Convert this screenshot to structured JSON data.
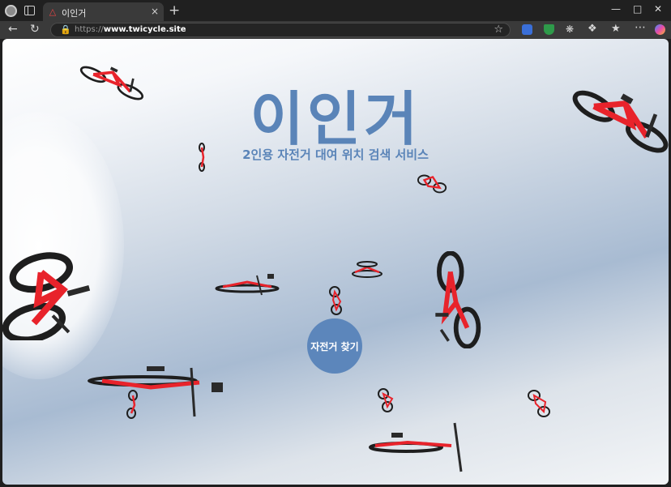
{
  "browser": {
    "tab_title": "이인거",
    "new_tab_symbol": "+",
    "close_symbol": "×",
    "url_scheme": "https://",
    "url_host": "www.twicycle.site"
  },
  "page": {
    "title": "이인거",
    "subtitle": "2인용 자전거 대여 위치 검색 서비스",
    "cta_label": "자전거 찾기"
  },
  "colors": {
    "accent": "#5a84b8",
    "bike_frame": "#e8232b",
    "tire": "#1e1e1e"
  }
}
